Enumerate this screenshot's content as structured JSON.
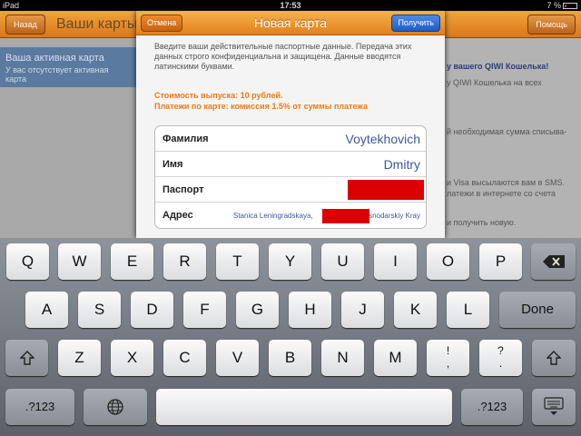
{
  "status": {
    "device": "iPad",
    "time": "17:53",
    "battery": "7 %"
  },
  "app": {
    "back_label": "Назад",
    "title": "Ваши карты",
    "help_label": "Помощь",
    "active_card_title": "Ваша активная карта",
    "active_card_sub": "У вас отсутствует активная карта",
    "right_lines": [
      "у вашего QIWI Кошелька!",
      "у QIWI Кошелька на всех",
      "й необходимая сумма списыва-",
      "и Visa высылаются вам в SMS.",
      "латежи в интернете со счета",
      "и получить новую."
    ]
  },
  "modal": {
    "cancel_label": "Отмена",
    "title": "Новая карта",
    "get_label": "Получить",
    "description": "Введите ваши действительные паспортные данные. Передача этих данных строго конфиденциальна и защищена. Данные вводятся латинскими буквами.",
    "cost": "Стоимость выпуска: 10 рублей.",
    "fee": "Платежи по карте: комиссия 1.5% от суммы платежа",
    "fields": [
      {
        "label": "Фамилия",
        "value": "Voytekhovich"
      },
      {
        "label": "Имя",
        "value": "Dmitry"
      },
      {
        "label": "Паспорт",
        "value": ""
      },
      {
        "label": "Адрес",
        "value_left": "Stanica Leningradskaya,",
        "value_right": "snodarskiy Kray"
      }
    ]
  },
  "keyboard": {
    "row1": [
      "Q",
      "W",
      "E",
      "R",
      "T",
      "Y",
      "U",
      "I",
      "O",
      "P"
    ],
    "row2": [
      "A",
      "S",
      "D",
      "F",
      "G",
      "H",
      "J",
      "K",
      "L"
    ],
    "row3": [
      "Z",
      "X",
      "C",
      "V",
      "B",
      "N",
      "M"
    ],
    "row3_punct": [
      [
        "!",
        ","
      ],
      [
        "?",
        "."
      ]
    ],
    "done_label": "Done",
    "numbers_label": ".?123",
    "icons": {
      "backspace": "backspace-icon",
      "shift": "shift-icon",
      "globe": "globe-icon",
      "hide": "hide-keyboard-icon"
    }
  }
}
